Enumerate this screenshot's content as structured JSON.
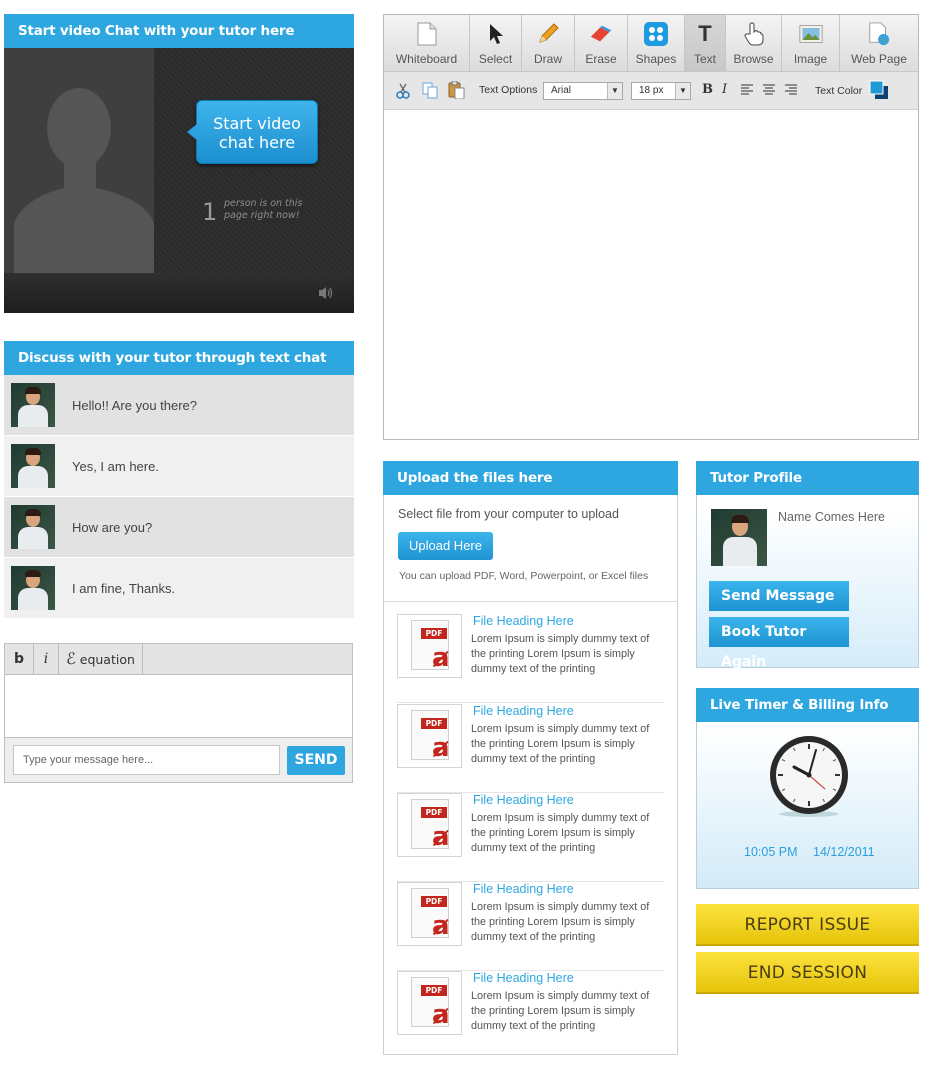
{
  "video": {
    "header": "Start video Chat with your tutor here",
    "start_button": "Start video chat here",
    "online_count": "1",
    "online_text": "person is on this page right now!",
    "volume_icon": "speaker-icon"
  },
  "chat": {
    "header": "Discuss with your tutor through text chat",
    "messages": [
      {
        "text": "Hello!! Are you there?"
      },
      {
        "text": "Yes, I am here."
      },
      {
        "text": "How are you?"
      },
      {
        "text": "I am fine, Thanks."
      }
    ],
    "toolbar": {
      "bold": "b",
      "italic": "i",
      "equation_symbol": "ℰ",
      "equation": "equation"
    },
    "input_placeholder": "Type your message here...",
    "send": "SEND"
  },
  "whiteboard": {
    "tools": [
      {
        "label": "Whiteboard",
        "icon": "page-icon"
      },
      {
        "label": "Select",
        "icon": "cursor-icon"
      },
      {
        "label": "Draw",
        "icon": "pencil-icon"
      },
      {
        "label": "Erase",
        "icon": "eraser-icon"
      },
      {
        "label": "Shapes",
        "icon": "shapes-icon"
      },
      {
        "label": "Text",
        "icon": "text-icon"
      },
      {
        "label": "Browse",
        "icon": "hand-icon"
      },
      {
        "label": "Image",
        "icon": "image-icon"
      },
      {
        "label": "Web Page",
        "icon": "globe-page-icon"
      }
    ],
    "active_tool": "Text",
    "text_options_label": "Text Options",
    "font": "Arial",
    "font_size": "18 px",
    "text_color_label": "Text Color",
    "text_color": "#1f9ad6"
  },
  "upload": {
    "header": "Upload the files here",
    "description": "Select file from your computer to upload",
    "button": "Upload Here",
    "note": "You can upload PDF, Word, Powerpoint, or Excel files",
    "files": [
      {
        "title": "File Heading Here",
        "desc": "Lorem Ipsum is simply dummy text of the printing Lorem Ipsum is simply dummy text of the printing"
      },
      {
        "title": "File Heading Here",
        "desc": "Lorem Ipsum is simply dummy text of the printing Lorem Ipsum is simply dummy text of the printing"
      },
      {
        "title": "File Heading Here",
        "desc": "Lorem Ipsum is simply dummy text of the printing Lorem Ipsum is simply dummy text of the printing"
      },
      {
        "title": "File Heading Here",
        "desc": "Lorem Ipsum is simply dummy text of the printing Lorem Ipsum is simply dummy text of the printing"
      },
      {
        "title": "File Heading Here",
        "desc": "Lorem Ipsum is simply dummy text of the printing Lorem Ipsum is simply dummy text of the printing"
      }
    ],
    "pdf_tag": "PDF"
  },
  "tutor": {
    "header": "Tutor Profile",
    "name": "Name Comes Here",
    "send_message": "Send Message",
    "book_again": "Book Tutor Again"
  },
  "timer": {
    "header": "Live Timer & Billing Info",
    "time": "10:05 PM",
    "date": "14/12/2011"
  },
  "actions": {
    "report": "REPORT ISSUE",
    "end": "END SESSION"
  },
  "colors": {
    "accent": "#2ea7e0",
    "yellow": "#f3d21f"
  }
}
